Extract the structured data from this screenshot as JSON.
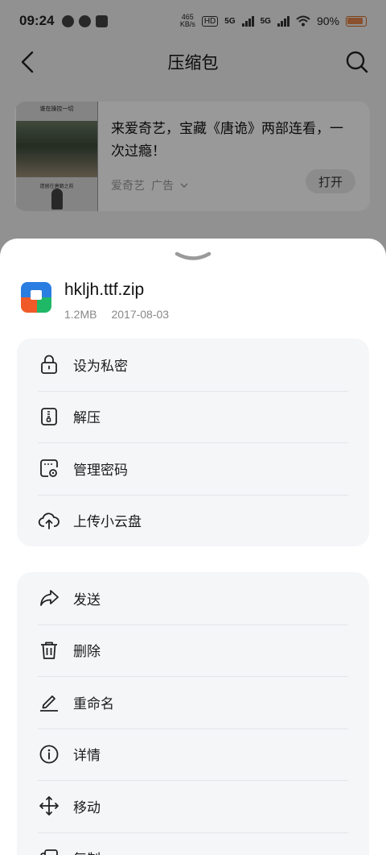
{
  "status_bar": {
    "time": "09:24",
    "network_speed_value": "465",
    "network_speed_unit": "KB/s",
    "hd_label": "HD",
    "sim1_label": "5G",
    "sim2_label": "5G",
    "battery_percent": "90%"
  },
  "nav": {
    "title": "压缩包",
    "back_icon": "back-arrow-icon",
    "search_icon": "search-icon"
  },
  "ad": {
    "thumb_caption_top": "谁在操控一切",
    "thumb_caption_bottom": "遗留在唐朝之前",
    "text": "来爱奇艺，宝藏《唐诡》两部连看，一次过瘾！",
    "source": "爱奇艺",
    "tag": "广告",
    "open_label": "打开"
  },
  "sheet": {
    "file": {
      "name": "hkljh.ttf.zip",
      "size": "1.2MB",
      "date": "2017-08-03"
    },
    "group1": [
      {
        "label": "设为私密",
        "icon": "lock-icon"
      },
      {
        "label": "解压",
        "icon": "unzip-icon"
      },
      {
        "label": "管理密码",
        "icon": "password-manage-icon"
      },
      {
        "label": "上传小云盘",
        "icon": "cloud-upload-icon"
      }
    ],
    "group2": [
      {
        "label": "发送",
        "icon": "share-icon"
      },
      {
        "label": "删除",
        "icon": "trash-icon"
      },
      {
        "label": "重命名",
        "icon": "pencil-icon"
      },
      {
        "label": "详情",
        "icon": "info-icon"
      },
      {
        "label": "移动",
        "icon": "move-icon"
      },
      {
        "label": "复制",
        "icon": "copy-icon"
      }
    ]
  }
}
